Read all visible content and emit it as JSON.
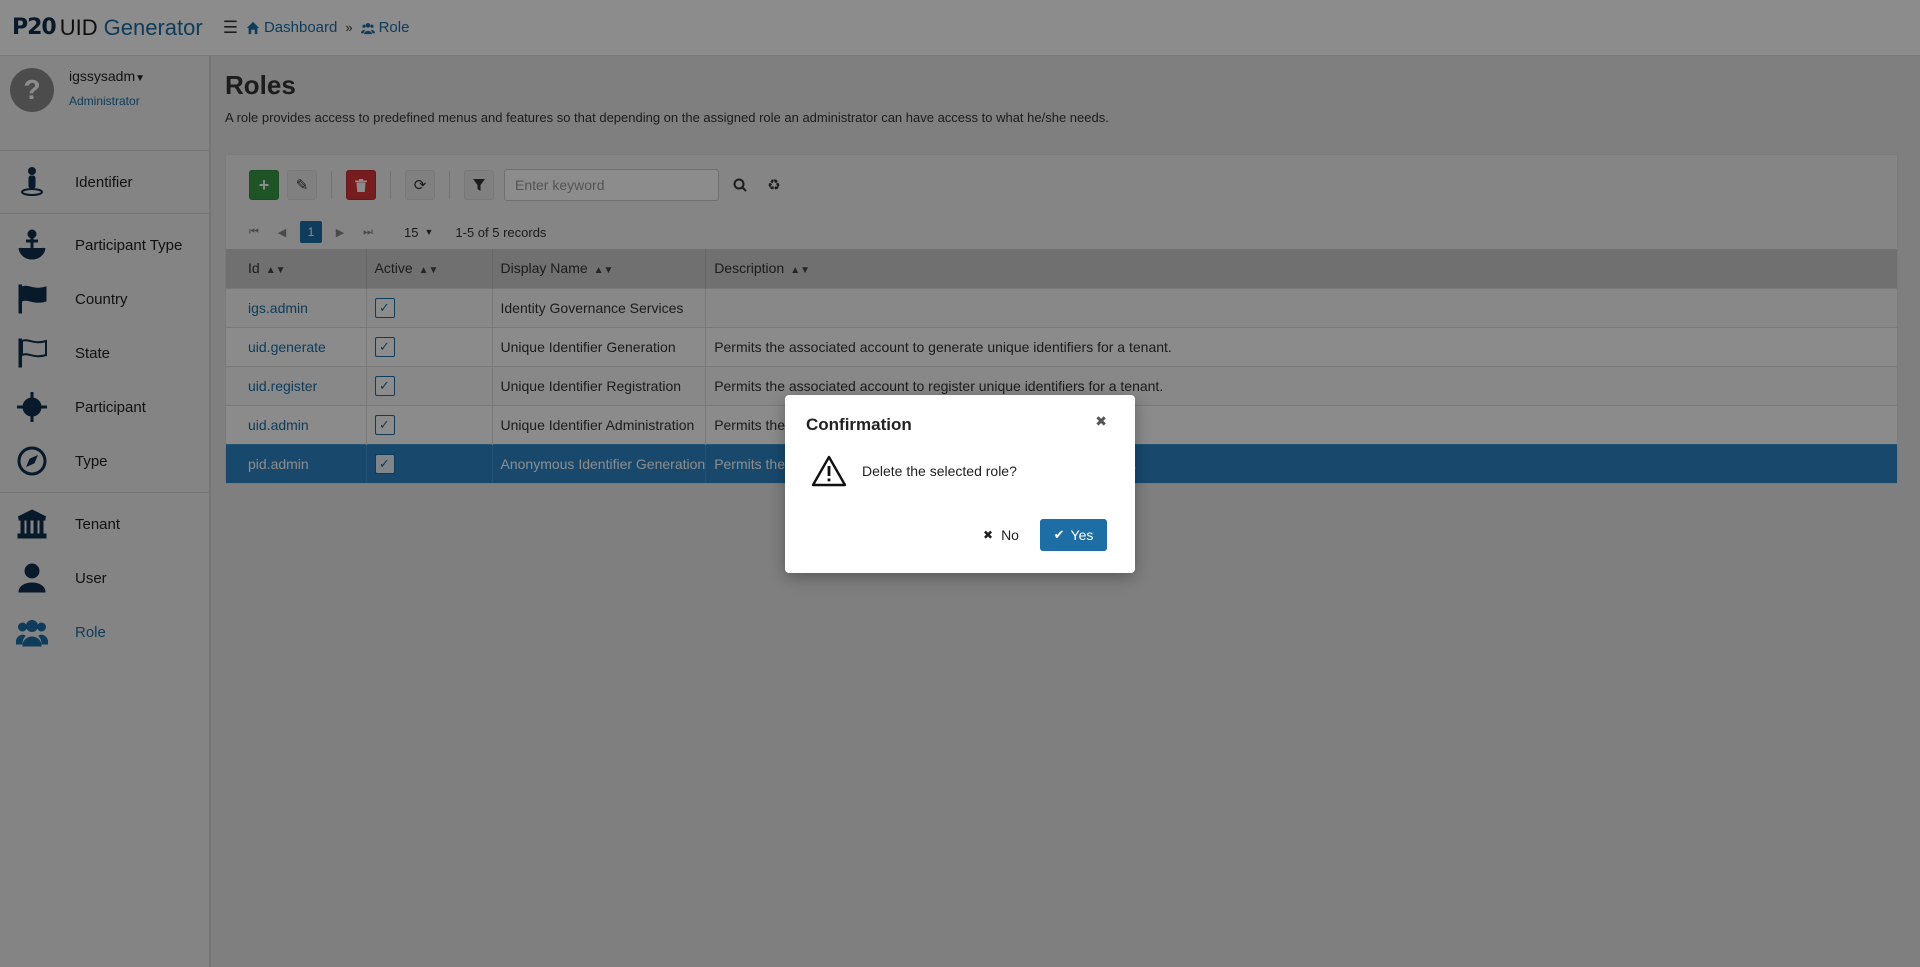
{
  "brand": {
    "logo": "P20",
    "app": "UID",
    "name": "Generator"
  },
  "breadcrumb": {
    "dashboard": "Dashboard",
    "separator": "»",
    "role": "Role"
  },
  "user": {
    "name": "igssysadm",
    "role": "Administrator",
    "avatar": "?"
  },
  "sidebar": {
    "groups": [
      [
        {
          "label": "Identifier",
          "icon": "identifier-icon"
        }
      ],
      [
        {
          "label": "Participant Type",
          "icon": "anchor-icon"
        },
        {
          "label": "Country",
          "icon": "flag-filled-icon"
        },
        {
          "label": "State",
          "icon": "flag-outline-icon"
        },
        {
          "label": "Participant",
          "icon": "crosshair-icon"
        },
        {
          "label": "Type",
          "icon": "compass-icon"
        }
      ],
      [
        {
          "label": "Tenant",
          "icon": "bank-icon"
        },
        {
          "label": "User",
          "icon": "user-icon"
        },
        {
          "label": "Role",
          "icon": "users-icon",
          "active": true
        }
      ]
    ]
  },
  "page": {
    "title": "Roles",
    "description": "A role provides access to predefined menus and features so that depending on the assigned role an administrator can have access to what he/she needs."
  },
  "toolbar": {
    "search_placeholder": "Enter keyword"
  },
  "pager": {
    "current_page": "1",
    "per_page": "15",
    "records": "1-5 of 5 records"
  },
  "table": {
    "columns": [
      "Id",
      "Active",
      "Display Name",
      "Description"
    ],
    "rows": [
      {
        "id": "igs.admin",
        "active": true,
        "display_name": "Identity Governance Services",
        "description": ""
      },
      {
        "id": "uid.generate",
        "active": true,
        "display_name": "Unique Identifier Generation",
        "description": "Permits the associated account to generate unique identifiers for a tenant."
      },
      {
        "id": "uid.register",
        "active": true,
        "display_name": "Unique Identifier Registration",
        "description": "Permits the associated account to register unique identifiers for a tenant."
      },
      {
        "id": "uid.admin",
        "active": true,
        "display_name": "Unique Identifier Administration",
        "description": "Permits the associated account to administer unique identifiers."
      },
      {
        "id": "pid.admin",
        "active": true,
        "display_name": "Anonymous Identifier Generation",
        "description": "Permits the associated account to administer anonymous identifiers.",
        "selected": true
      }
    ]
  },
  "dialog": {
    "title": "Confirmation",
    "message": "Delete the selected role?",
    "no_label": "No",
    "yes_label": "Yes"
  },
  "colors": {
    "accent": "#1c6ea4",
    "add": "#3a9a47",
    "delete": "#d9353a",
    "selected_row": "#2d86c6"
  }
}
